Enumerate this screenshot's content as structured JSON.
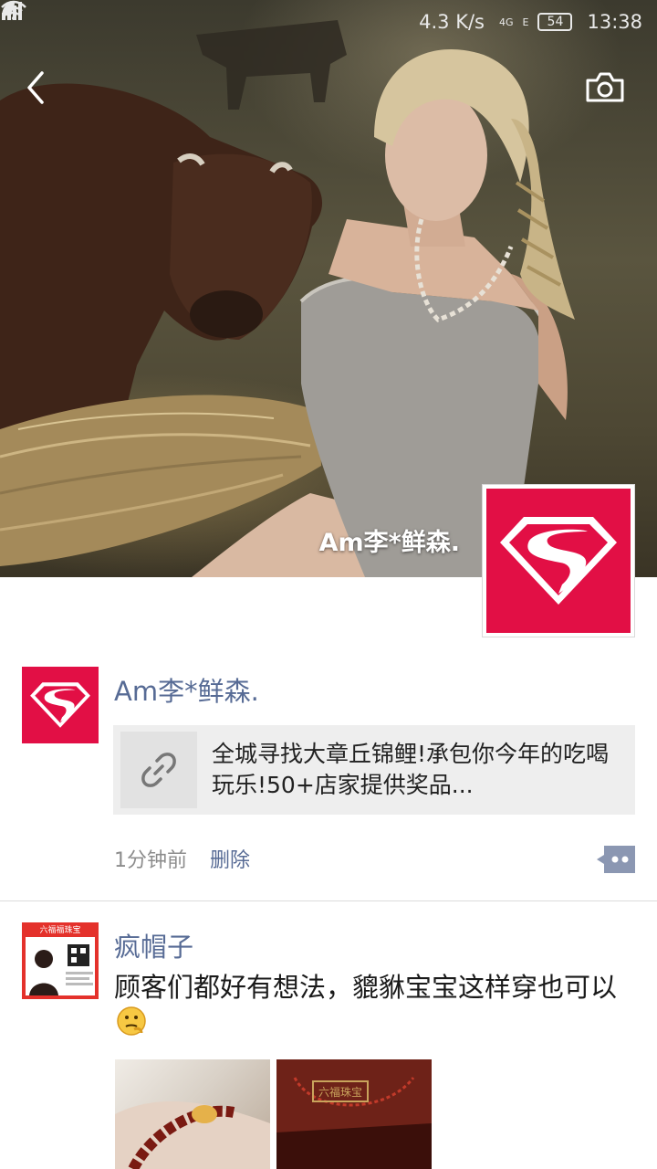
{
  "status_bar": {
    "net_speed": "4.3 K/s",
    "network_4g": "4G",
    "network_e": "E",
    "battery": "54",
    "time": "13:38"
  },
  "header": {
    "back_icon": "chevron-left-icon",
    "camera_icon": "camera-icon",
    "cover_name": "Am李*鲜森."
  },
  "posts": [
    {
      "author": "Am李*鲜森.",
      "avatar": "superman-logo",
      "link_text": "全城寻找大章丘锦鲤!承包你今年的吃喝玩乐!50+店家提供奖品...",
      "link_icon": "link-icon",
      "time": "1分钟前",
      "delete_label": "删除",
      "more_icon": "comment-more-icon"
    },
    {
      "author": "疯帽子",
      "avatar_banner": "六福福珠宝",
      "text": "顾客们都好有想法，貔貅宝宝这样穿也可以",
      "emoji": "thinking-emoji-icon",
      "photo_brand": "六福珠宝"
    }
  ],
  "colors": {
    "link_blue": "#576b95",
    "brand_red": "#e20f45",
    "card_bg": "#eeeeee",
    "meta_gray": "#8c8c8c"
  }
}
